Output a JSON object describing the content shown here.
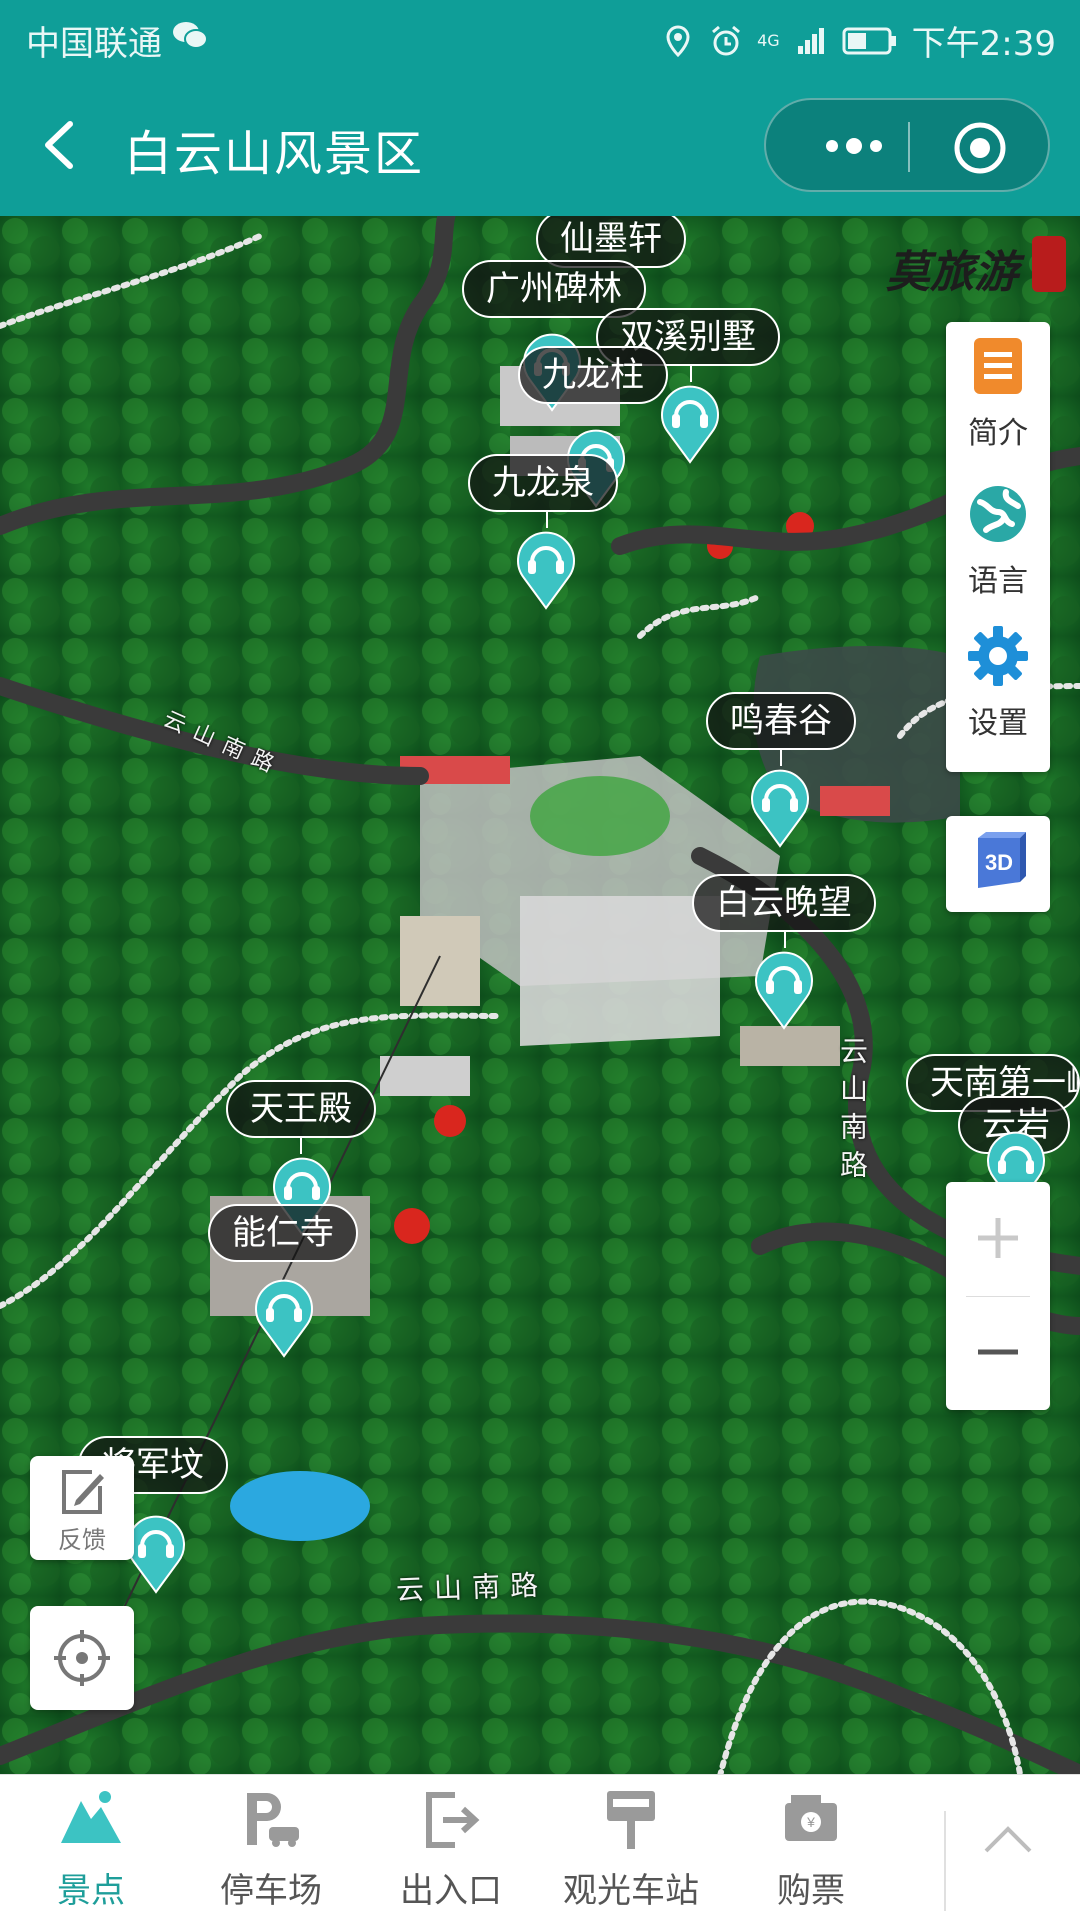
{
  "status_bar": {
    "carrier": "中国联通",
    "network": "4G",
    "time": "下午2:39"
  },
  "nav_bar": {
    "title": "白云山风景区"
  },
  "map": {
    "brand": "莫旅游",
    "pois": [
      {
        "label": "仙墨轩"
      },
      {
        "label": "广州碑林"
      },
      {
        "label": "双溪别墅"
      },
      {
        "label": "九龙柱"
      },
      {
        "label": "九龙泉"
      },
      {
        "label": "鸣春谷"
      },
      {
        "label": "白云晚望"
      },
      {
        "label": "天南第一峰"
      },
      {
        "label": "云岩"
      },
      {
        "label": "天王殿"
      },
      {
        "label": "能仁寺"
      },
      {
        "label": "将军坟"
      }
    ],
    "road_labels": [
      "云山南路",
      "云山南路",
      "云山南路"
    ]
  },
  "tools": {
    "intro": "简介",
    "language": "语言",
    "settings": "设置",
    "btn3d": "3D",
    "feedback": "反馈"
  },
  "bottom_nav": {
    "tabs": [
      {
        "label": "景点",
        "icon": "mountain-icon",
        "active": true
      },
      {
        "label": "停车场",
        "icon": "parking-icon",
        "active": false
      },
      {
        "label": "出入口",
        "icon": "exit-icon",
        "active": false
      },
      {
        "label": "观光车站",
        "icon": "bus-stop-icon",
        "active": false
      },
      {
        "label": "购票",
        "icon": "ticket-icon",
        "active": false
      }
    ]
  },
  "colors": {
    "header": "#0f9e98",
    "accent": "#1e9e9a",
    "pin": "#3cc3c3",
    "intro_icon": "#f08a2c",
    "globe_icon": "#2aa8a6",
    "gear_icon": "#1e8fd8",
    "btn3d_icon": "#4a78d8"
  }
}
